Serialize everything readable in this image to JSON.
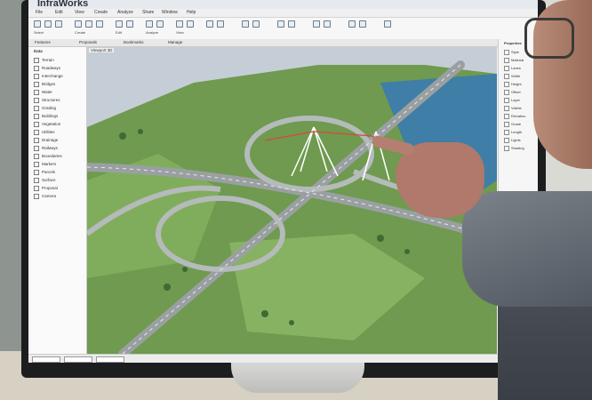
{
  "app": {
    "title": "InfraWorks",
    "menu": [
      "File",
      "Edit",
      "View",
      "Create",
      "Analyze",
      "Share",
      "Window",
      "Help"
    ],
    "tabs": [
      "Features",
      "Proposals",
      "Bookmarks",
      "Manage"
    ]
  },
  "ribbon": {
    "groups": [
      "Select",
      "Create",
      "Edit",
      "Analyze",
      "View"
    ]
  },
  "left_panel": {
    "header": "Data",
    "items": [
      "Terrain",
      "Roadways",
      "Interchange",
      "Bridges",
      "Water",
      "Structures",
      "Grading",
      "Buildings",
      "Vegetation",
      "Utilities",
      "Drainage",
      "Railways",
      "Boundaries",
      "Markers",
      "Parcels",
      "Surface",
      "Proposal",
      "Camera"
    ]
  },
  "viewport": {
    "label": "Viewport 3D"
  },
  "right_panel": {
    "header": "Properties",
    "items": [
      "Style",
      "Material",
      "Lanes",
      "Width",
      "Height",
      "Offset",
      "Layer",
      "Visible",
      "Elevation",
      "Grade",
      "Length",
      "Lights",
      "Shading"
    ]
  },
  "colors": {
    "terrain": "#7aa35a",
    "water": "#3f7ea6",
    "road": "#9aa0a2",
    "accent": "#d9483b"
  }
}
